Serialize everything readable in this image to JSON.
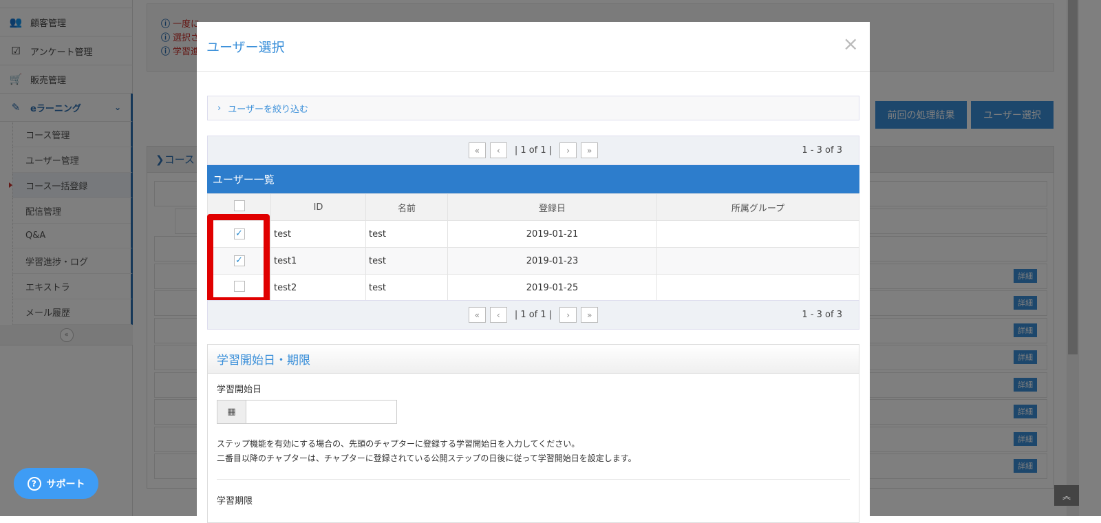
{
  "sidebar": {
    "items": [
      {
        "label": "顧客管理",
        "icon": "users-icon"
      },
      {
        "label": "アンケート管理",
        "icon": "check-square-icon"
      },
      {
        "label": "販売管理",
        "icon": "cart-icon"
      },
      {
        "label": "eラーニング",
        "icon": "pencil-icon"
      }
    ],
    "sub_items": [
      "コース管理",
      "ユーザー管理",
      "コース一括登録",
      "配信管理",
      "Q&A",
      "学習進捗・ログ",
      "エキストラ",
      "メール履歴"
    ],
    "collapse": "«"
  },
  "info": [
    "一度に",
    "選択さ",
    "学習進"
  ],
  "buttons": {
    "prev_result": "前回の処理結果",
    "user_select": "ユーザー選択"
  },
  "course": {
    "header": "コース",
    "detail_label": "詳細"
  },
  "modal": {
    "title": "ユーザー選択",
    "close": "×",
    "filter": "ユーザーを絞り込む",
    "pager": {
      "first": "«",
      "prev": "‹",
      "page": "| 1 of 1 |",
      "next": "›",
      "last": "»",
      "count": "1 - 3 of 3"
    },
    "list_title": "ユーザー一覧",
    "columns": [
      "ID",
      "名前",
      "登録日",
      "所属グループ"
    ],
    "rows": [
      {
        "checked": true,
        "id": "test",
        "name": "test",
        "date": "2019-01-21",
        "group": ""
      },
      {
        "checked": true,
        "id": "test1",
        "name": "test",
        "date": "2019-01-23",
        "group": ""
      },
      {
        "checked": false,
        "id": "test2",
        "name": "test",
        "date": "2019-01-25",
        "group": ""
      }
    ],
    "section_title": "学習開始日・期限",
    "start_label": "学習開始日",
    "start_value": "",
    "help1": "ステップ機能を有効にする場合の、先頭のチャプターに登録する学習開始日を入力してください。",
    "help2": "二番目以降のチャプターは、チャプターに登録されている公開ステップの日後に従って学習開始日を設定します。",
    "deadline_label": "学習期限"
  },
  "support": "サポート"
}
